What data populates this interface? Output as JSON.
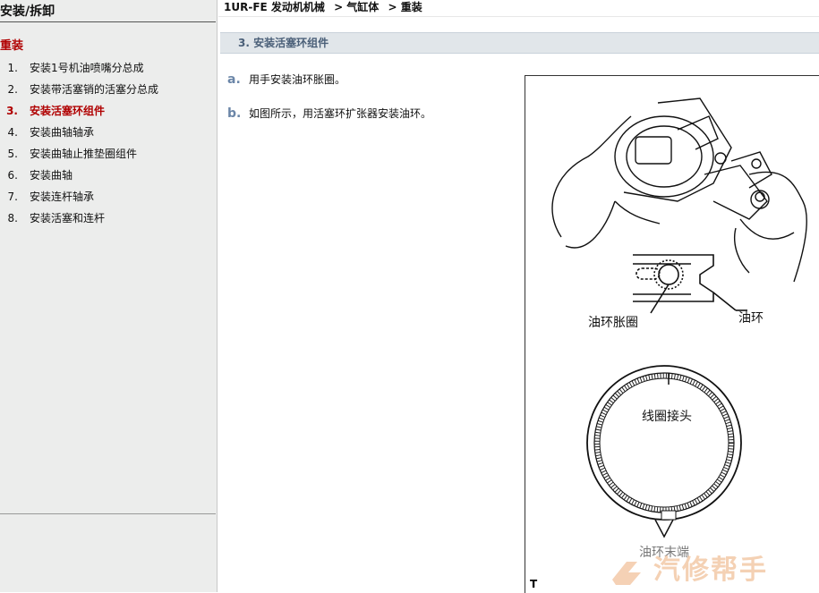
{
  "sidebar": {
    "title": "安装/拆卸",
    "section": "重装",
    "items": [
      {
        "num": "1.",
        "label": "安装1号机油喷嘴分总成"
      },
      {
        "num": "2.",
        "label": "安装带活塞销的活塞分总成"
      },
      {
        "num": "3.",
        "label": "安装活塞环组件"
      },
      {
        "num": "4.",
        "label": "安装曲轴轴承"
      },
      {
        "num": "5.",
        "label": "安装曲轴止推垫圈组件"
      },
      {
        "num": "6.",
        "label": "安装曲轴"
      },
      {
        "num": "7.",
        "label": "安装连杆轴承"
      },
      {
        "num": "8.",
        "label": "安装活塞和连杆"
      }
    ],
    "active_index": 2
  },
  "breadcrumb": [
    "1UR-FE 发动机机械",
    "> 气缸体",
    "> 重装"
  ],
  "step": {
    "title": "3. 安装活塞环组件",
    "substeps": [
      {
        "letter": "a.",
        "text": "用手安装油环胀圈。"
      },
      {
        "letter": "b.",
        "text": "如图所示，用活塞环扩张器安装油环。"
      }
    ]
  },
  "figure": {
    "label_expander": "油环胀圈",
    "label_oil_ring": "油环",
    "label_joint": "线圈接头",
    "label_ring_end": "油环末端",
    "code": "T"
  },
  "watermark": {
    "text": "汽修帮手"
  },
  "colors": {
    "active": "#b00000",
    "step_letter": "#6b86a8",
    "header_bg": "#e1e6ea",
    "sidebar_bg": "#ecedec"
  }
}
